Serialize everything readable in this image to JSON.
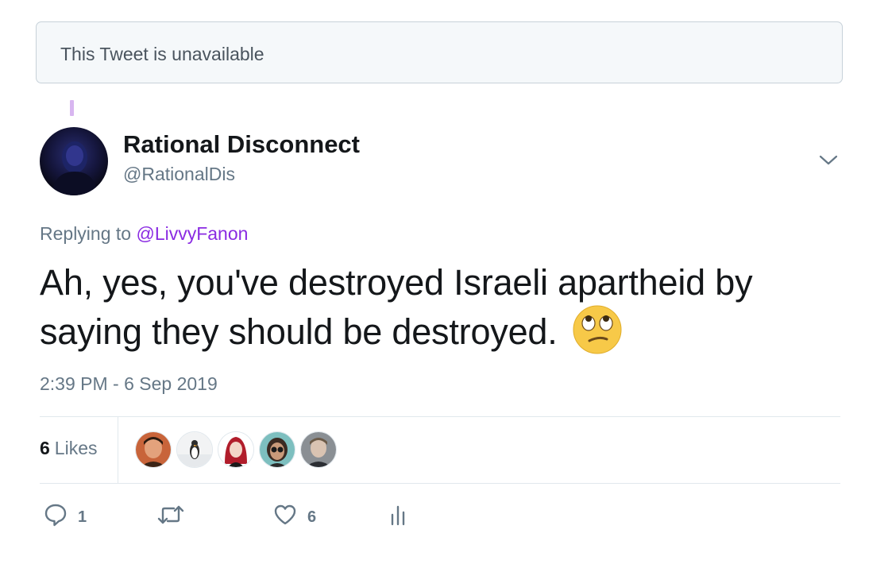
{
  "unavailable_notice": {
    "text": "This Tweet is unavailable"
  },
  "author": {
    "display_name": "Rational Disconnect",
    "handle": "@RationalDis"
  },
  "reply": {
    "prefix": "Replying to",
    "to_handle": "@LivvyFanon"
  },
  "tweet": {
    "text": "Ah, yes, you've destroyed Israeli apartheid by saying they should be destroyed.",
    "emoji": "eye-roll-emoji",
    "timestamp": "2:39 PM - 6 Sep 2019"
  },
  "stats": {
    "likes_count": "6",
    "likes_label": "Likes"
  },
  "likers": [
    {
      "name": "liker-avatar-1"
    },
    {
      "name": "liker-avatar-2"
    },
    {
      "name": "liker-avatar-3"
    },
    {
      "name": "liker-avatar-4"
    },
    {
      "name": "liker-avatar-5"
    }
  ],
  "actions": {
    "reply_count": "1",
    "like_count": "6",
    "icons": [
      "reply-icon",
      "retweet-icon",
      "like-icon",
      "analytics-icon"
    ]
  },
  "colors": {
    "link": "#8a2be2",
    "secondary_text": "#657786",
    "thread_line": "#d8b6f0"
  }
}
